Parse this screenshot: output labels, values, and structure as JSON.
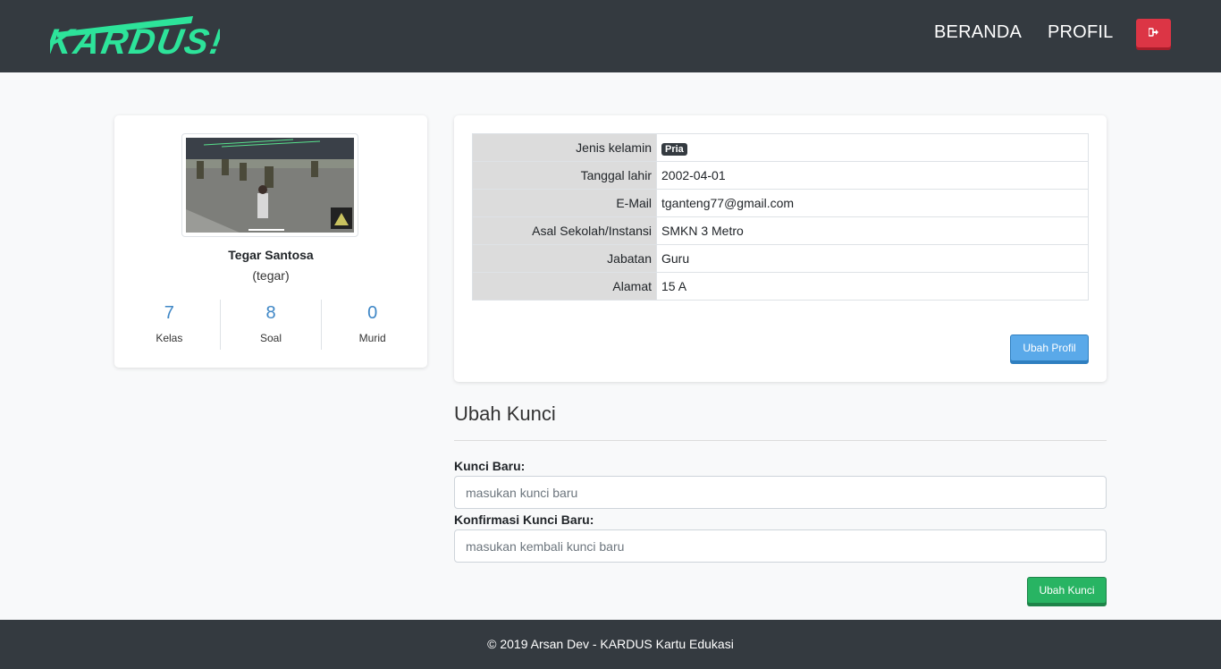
{
  "navbar": {
    "brand": "KARDUS!",
    "links": [
      {
        "label": "BERANDA"
      },
      {
        "label": "PROFIL"
      }
    ],
    "logout_icon": "sign-out-icon",
    "logout_color": "#dc3545"
  },
  "profile": {
    "name": "Tegar Santosa",
    "username": "(tegar)",
    "avatar_icon": "profile-photo-game-screenshot",
    "stats": [
      {
        "value": "7",
        "label": "Kelas"
      },
      {
        "value": "8",
        "label": "Soal"
      },
      {
        "value": "0",
        "label": "Murid"
      }
    ]
  },
  "details": {
    "rows": [
      {
        "key": "Jenis kelamin",
        "value": "Pria",
        "badge": true
      },
      {
        "key": "Tanggal lahir",
        "value": "2002-04-01"
      },
      {
        "key": "E-Mail",
        "value": "tganteng77@gmail.com"
      },
      {
        "key": "Asal Sekolah/Instansi",
        "value": "SMKN 3 Metro"
      },
      {
        "key": "Jabatan",
        "value": "Guru"
      },
      {
        "key": "Alamat",
        "value": "15 A"
      }
    ],
    "edit_button": "Ubah Profil"
  },
  "change_password": {
    "title": "Ubah Kunci",
    "new_label": "Kunci Baru:",
    "new_placeholder": "masukan kunci baru",
    "confirm_label": "Konfirmasi Kunci Baru:",
    "confirm_placeholder": "masukan kembali kunci baru",
    "submit_button": "Ubah Kunci"
  },
  "footer": {
    "text": "© 2019 Arsan Dev - KARDUS Kartu Edukasi"
  },
  "colors": {
    "navbar": "#343a40",
    "brand": "#2de39a",
    "stat_value": "#3f87c6",
    "primary_button": "#5aa9e9",
    "success_button": "#28b463"
  }
}
